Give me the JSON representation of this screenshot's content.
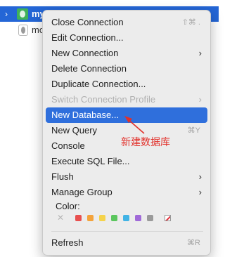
{
  "tree": {
    "selected_label": "my",
    "second_label": "mo"
  },
  "menu": {
    "items": [
      {
        "label": "Close Connection",
        "shortcut": "⇧⌘ ."
      },
      {
        "label": "Edit Connection..."
      },
      {
        "label": "New Connection",
        "arrow": "›"
      },
      {
        "label": "Delete Connection"
      },
      {
        "label": "Duplicate Connection..."
      },
      {
        "label": "Switch Connection Profile",
        "arrow": "›"
      },
      {
        "label": "New Database..."
      },
      {
        "label": "New Query",
        "shortcut": "⌘Y"
      },
      {
        "label": "Console"
      },
      {
        "label": "Execute SQL File..."
      },
      {
        "label": "Flush",
        "arrow": "›"
      },
      {
        "label": "Manage Group",
        "arrow": "›"
      }
    ],
    "color_title": "Color:",
    "colors": [
      "#e8504f",
      "#f4a33b",
      "#f5d34b",
      "#5bc65e",
      "#41b3e5",
      "#a06ad8",
      "#9a9a9a"
    ],
    "refresh": {
      "label": "Refresh",
      "shortcut": "⌘R"
    }
  },
  "annotation": {
    "text": "新建数据库",
    "color": "#e2302a"
  }
}
